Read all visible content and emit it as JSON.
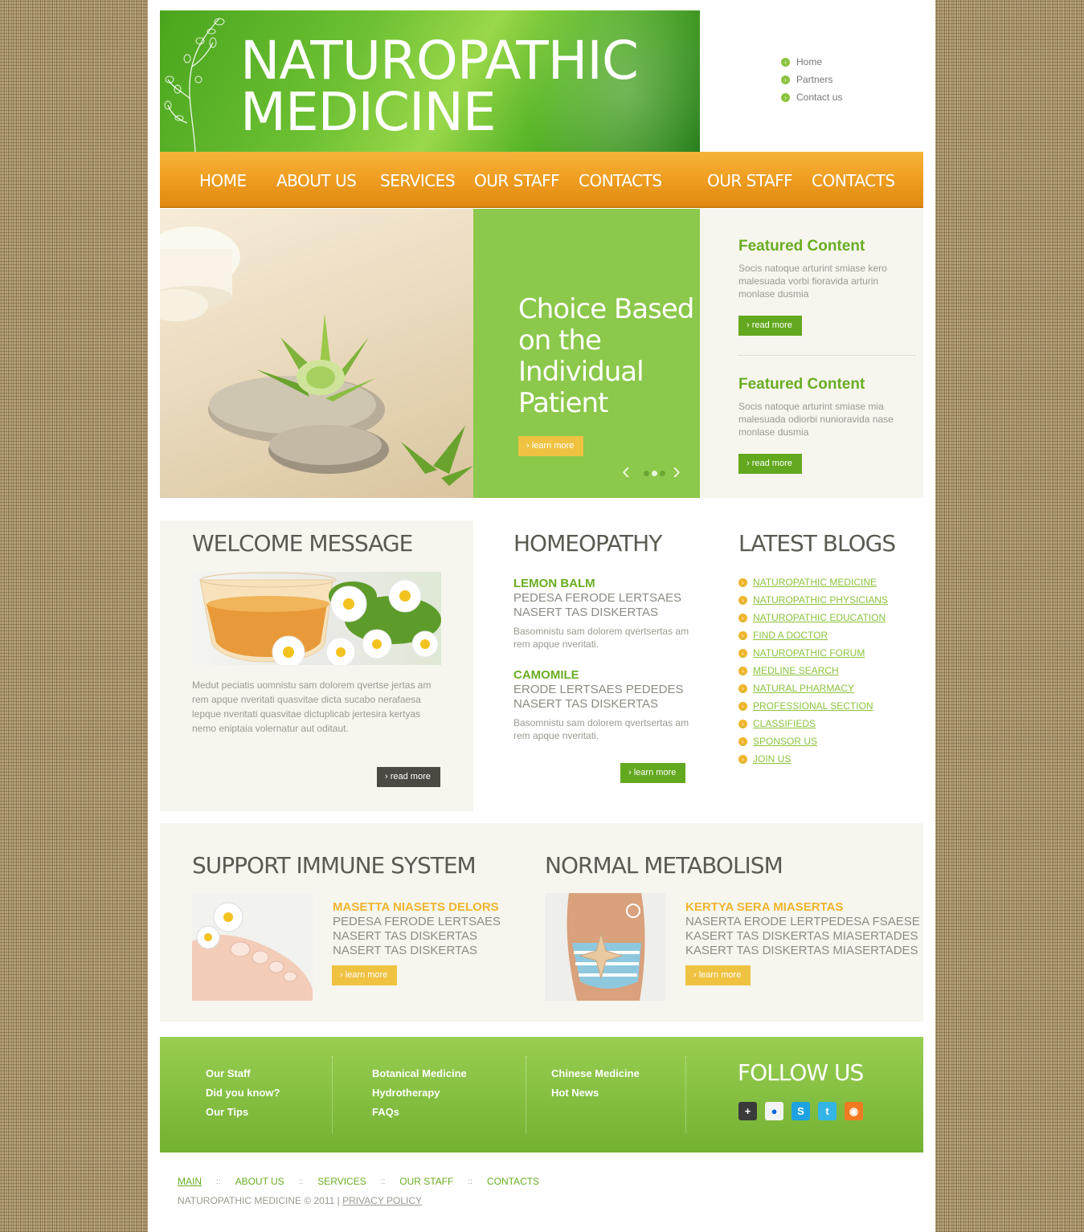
{
  "header": {
    "title_line1": "NATUROPATHIC",
    "title_line2": "MEDICINE",
    "top_links": [
      "Home",
      "Partners",
      "Contact us"
    ]
  },
  "nav": {
    "items": [
      "HOME",
      "ABOUT US",
      "SERVICES",
      "OUR STAFF",
      "CONTACTS",
      "OUR STAFF",
      "CONTACTS"
    ]
  },
  "slider": {
    "headline": "Choice Based on the Individual Patient",
    "button": "learn more",
    "slide_count": 3,
    "active_slide": 2
  },
  "featured": [
    {
      "title": "Featured Content",
      "text": "Socis natoque arturint smiase kero malesuada vorbi fioravida arturin monlase dusmia",
      "button": "read more"
    },
    {
      "title": "Featured Content",
      "text": "Socis natoque arturint smiase mia malesuada odiorbi nunioravida nase monlase dusmia",
      "button": "read more"
    }
  ],
  "welcome": {
    "title": "WELCOME MESSAGE",
    "text": "Medut peciatis uomnistu sam dolorem qvertse jertas am rem apque nveritati quasvitae dicta sucabo nerafaesa lepque nveritati quasvitae dictuplicab jertesira kertyas nemo eniptaia volernatur aut oditaut.",
    "button": "read more"
  },
  "homeopathy": {
    "title": "HOMEOPATHY",
    "items": [
      {
        "key": "LEMON BALM",
        "sub1": "PEDESA FERODE LERTSAES",
        "sub2": "NASERT TAS DISKERTAS",
        "text": "Basomnistu sam dolorem qvertsertas am rem apque nveritati."
      },
      {
        "key": "CAMOMILE",
        "sub1": "ERODE LERTSAES PEDEDES",
        "sub2": "NASERT TAS DISKERTAS",
        "text": "Basomnistu sam dolorem qvertsertas am rem apque nveritati."
      }
    ],
    "button": "learn more"
  },
  "blogs": {
    "title": "LATEST BLOGS",
    "items": [
      "NATUROPATHIC MEDICINE",
      "NATUROPATHIC PHYSICIANS",
      "NATUROPATHIC EDUCATION",
      "FIND A DOCTOR",
      "NATUROPATHIC FORUM",
      "MEDLINE SEARCH",
      "NATURAL PHARMACY",
      "PROFESSIONAL SECTION",
      "CLASSIFIEDS",
      "SPONSOR US",
      "JOIN US"
    ]
  },
  "promo": [
    {
      "title": "SUPPORT IMMUNE SYSTEM",
      "key": "MASETTA NIASETS DELORS",
      "sub1": "PEDESA FERODE LERTSAES",
      "sub2": "NASERT TAS DISKERTAS",
      "sub3": "NASERT TAS DISKERTAS",
      "button": "learn more"
    },
    {
      "title": "NORMAL METABOLISM",
      "key": "KERTYA SERA MIASERTAS",
      "sub1": "NASERTA ERODE LERTPEDESA FSAESE",
      "sub2": "KASERT TAS DISKERTAS MIASERTADES",
      "sub3": "KASERT TAS DISKERTAS MIASERTADES",
      "button": "learn more"
    }
  ],
  "footer": {
    "col1": [
      "Our Staff",
      "Did you know?",
      "Our Tips"
    ],
    "col2": [
      "Botanical Medicine",
      "Hydrotherapy",
      "FAQs"
    ],
    "col3": [
      "Chinese Medicine",
      "Hot News"
    ],
    "follow_title": "FOLLOW US",
    "social_icons": [
      "googleplus-icon",
      "flickr-icon",
      "skype-icon",
      "twitter-icon",
      "rss-icon"
    ],
    "bottom_nav": [
      "MAIN",
      "ABOUT US",
      "SERVICES",
      "OUR STAFF",
      "CONTACTS"
    ],
    "bottom_sep": "::",
    "copyright": "NATUROPATHIC MEDICINE © 2011  |",
    "privacy": "PRIVACY POLICY"
  },
  "colors": {
    "accent_green": "#8cc84b",
    "accent_orange": "#f0a023",
    "button_yellow": "#f0c242",
    "button_green": "#63a91f"
  }
}
